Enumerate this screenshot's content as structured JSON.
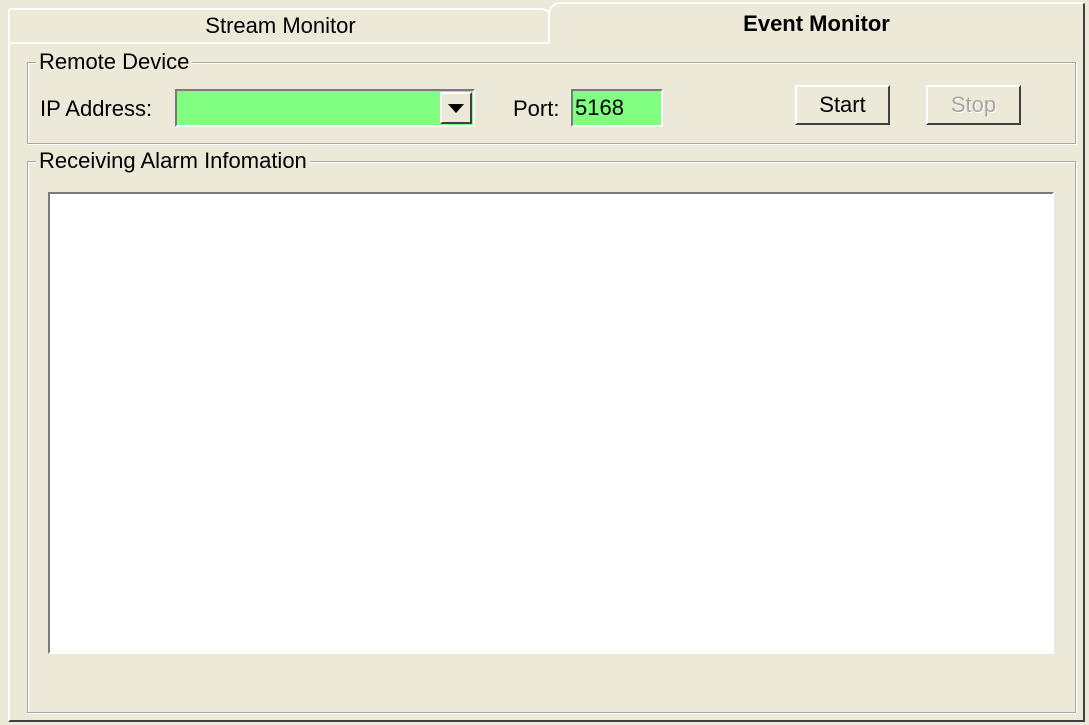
{
  "tabs": [
    {
      "label": "Stream Monitor",
      "active": false
    },
    {
      "label": "Event Monitor",
      "active": true
    }
  ],
  "remote_device": {
    "legend": "Remote Device",
    "ip_label": "IP Address:",
    "ip_value": "",
    "port_label": "Port:",
    "port_value": "5168",
    "start_label": "Start",
    "stop_label": "Stop",
    "stop_enabled": false
  },
  "alarm": {
    "legend": "Receiving Alarm Infomation",
    "items": []
  },
  "colors": {
    "field_bg": "#80ff80",
    "window_bg": "#ece9d8"
  },
  "icons": {
    "combo_dropdown": "chevron-down-icon"
  }
}
